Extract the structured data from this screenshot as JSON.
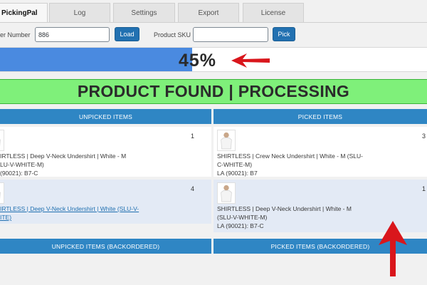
{
  "tabs": [
    "PickingPal",
    "Log",
    "Settings",
    "Export",
    "License"
  ],
  "form": {
    "order_label": "er Number",
    "order_value": "886",
    "load_button": "Load",
    "sku_label": "Product SKU",
    "sku_value": "",
    "pick_button": "Pick"
  },
  "progress": {
    "value": 45,
    "label": "45%"
  },
  "status_banner": "PRODUCT FOUND | PROCESSING",
  "unpicked": {
    "header": "UNPICKED ITEMS",
    "items": [
      {
        "lines": [
          "IRTLESS | Deep V-Neck Undershirt | White - M",
          "LU-V-WHITE-M)",
          "(90021): B7-C"
        ],
        "qty": "1"
      },
      {
        "lines": [
          "IRTLESS | Deep V-Neck Undershirt | White (SLU-V-",
          "ITE)"
        ],
        "qty": "4"
      }
    ]
  },
  "picked": {
    "header": "PICKED ITEMS",
    "items": [
      {
        "lines": [
          "SHIRTLESS | Crew Neck Undershirt | White - M (SLU-",
          "C-WHITE-M)",
          "LA (90021): B7"
        ],
        "qty": "3"
      },
      {
        "lines": [
          "SHIRTLESS | Deep V-Neck Undershirt | White - M",
          "(SLU-V-WHITE-M)",
          "LA (90021): B7-C"
        ],
        "qty": "1"
      }
    ]
  },
  "unpicked_backordered_header": "UNPICKED ITEMS (BACKORDERED)",
  "picked_backordered_header": "PICKED ITEMS (BACKORDERED)",
  "colors": {
    "tab_bg": "#e4e4e4",
    "button_blue": "#2271b1",
    "progress_fill": "#4a8ae0",
    "banner_green": "#7ff07a",
    "panel_header": "#2f86c4",
    "annotation_red": "#d9161c"
  },
  "icons": [
    "shirt-thumbnail",
    "red-arrow-left",
    "red-arrow-up"
  ]
}
